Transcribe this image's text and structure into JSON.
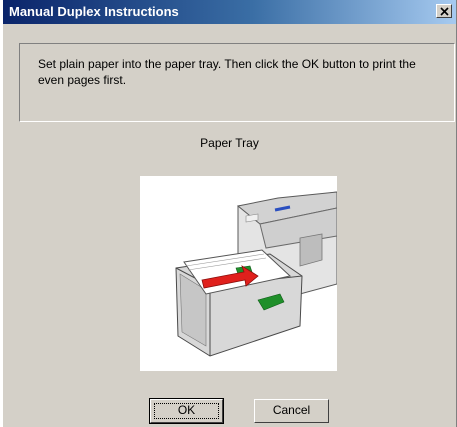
{
  "window": {
    "title": "Manual Duplex Instructions"
  },
  "dialog": {
    "message": "Set plain paper into the paper tray. Then click the OK button to print the even pages first.",
    "illustration_label": "Paper Tray",
    "buttons": {
      "ok_label": "OK",
      "cancel_label": "Cancel"
    }
  },
  "icons": {
    "close": "close-icon",
    "illustration": "printer-paper-tray-illustration"
  }
}
